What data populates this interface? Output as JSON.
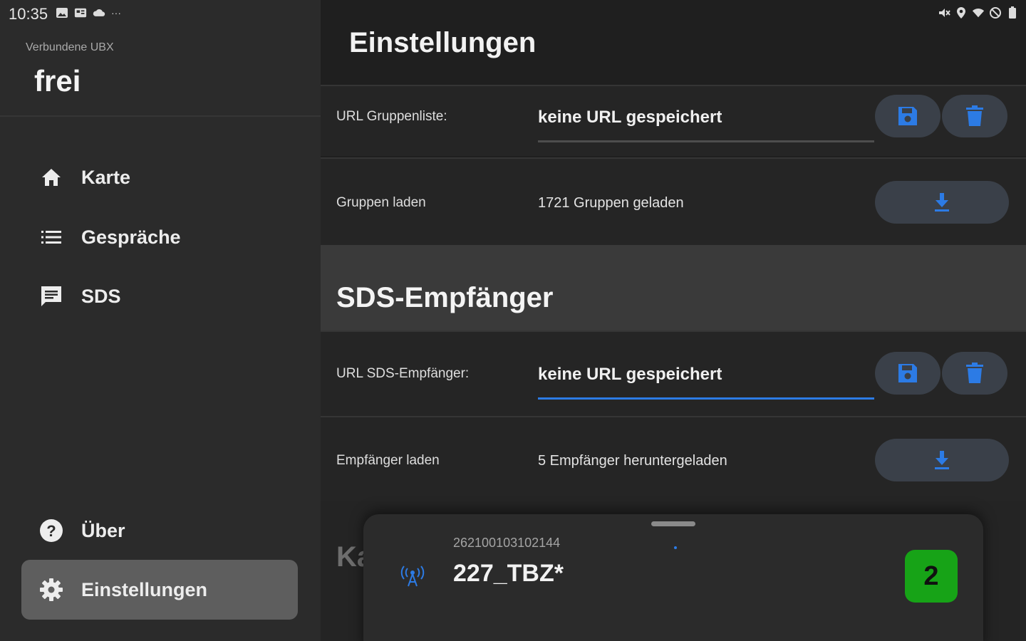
{
  "status_bar": {
    "time": "10:35",
    "left_icons": [
      "image-icon",
      "photo-icon",
      "cloud-icon",
      "more-dots-icon"
    ],
    "more": "···",
    "right_icons": [
      "mute-icon",
      "location-icon",
      "wifi-icon",
      "dnd-icon",
      "battery-icon"
    ]
  },
  "drawer": {
    "subtitle": "Verbundene UBX",
    "title": "frei",
    "items": [
      {
        "label": "Karte",
        "icon": "home-icon"
      },
      {
        "label": "Gespräche",
        "icon": "list-icon"
      },
      {
        "label": "SDS",
        "icon": "message-icon"
      },
      {
        "label": "Über",
        "icon": "help-icon"
      },
      {
        "label": "Einstellungen",
        "icon": "gear-icon",
        "active": true
      }
    ]
  },
  "main": {
    "title": "Einstellungen",
    "groups_url": {
      "label": "URL Gruppenliste:",
      "value": "keine URL gespeichert"
    },
    "groups_load": {
      "label": "Gruppen laden",
      "status": "1721 Gruppen geladen"
    },
    "sds_section_title": "SDS-Empfänger",
    "sds_url": {
      "label": "URL SDS-Empfänger:",
      "value": "keine URL gespeichert"
    },
    "sds_load": {
      "label": "Empfänger laden",
      "status": "5 Empfänger heruntergeladen"
    },
    "partial_section": "Ka"
  },
  "sheet": {
    "id": "262100103102144",
    "name": "227_TBZ*",
    "badge": "2"
  },
  "colors": {
    "accent": "#2c7be5",
    "badge": "#17a317",
    "drawer_bg": "#2b2b2b",
    "active_item": "#5e5e5e"
  }
}
